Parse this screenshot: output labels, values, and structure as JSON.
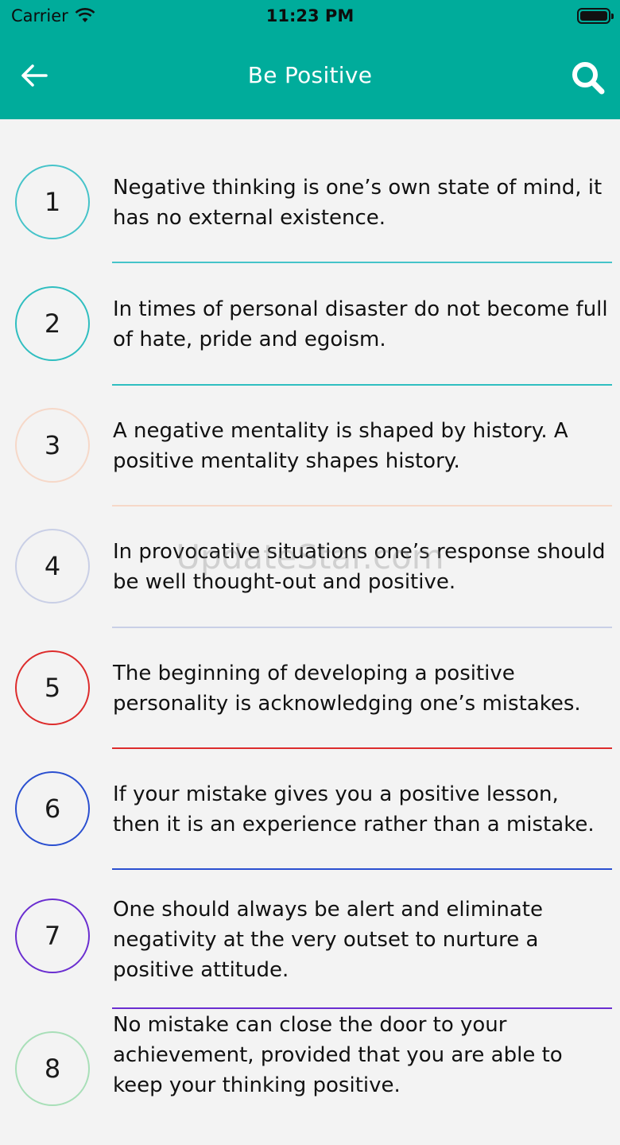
{
  "status": {
    "carrier": "Carrier",
    "time": "11:23 PM"
  },
  "header": {
    "title": "Be Positive",
    "back_icon": "arrow-left-icon",
    "search_icon": "search-icon"
  },
  "colors": {
    "header_bg": "#00ac9b"
  },
  "watermark": "UpdateStar.com",
  "quotes": [
    {
      "number": "1",
      "text": "Negative thinking is one’s own state of mind, it has no external existence.",
      "color": "#45c3c9"
    },
    {
      "number": "2",
      "text": "In times of personal disaster do not become full of hate, pride and egoism.",
      "color": "#2fbec0"
    },
    {
      "number": "3",
      "text": "A negative mentality is shaped by history. A positive mentality shapes history.",
      "color": "#f6d8c8"
    },
    {
      "number": "4",
      "text": "In provocative situations one’s response should be well thought-out and positive.",
      "color": "#c9cfe6"
    },
    {
      "number": "5",
      "text": "The beginning of developing a positive personality is acknowledging one’s mistakes.",
      "color": "#dd2c2c"
    },
    {
      "number": "6",
      "text": "If your mistake gives you a positive lesson, then it is an experience rather than a mistake.",
      "color": "#2a4fd0"
    },
    {
      "number": "7",
      "text": "One should always be alert and eliminate negativity at the very outset to nurture a positive attitude.",
      "color": "#6a2ed0"
    },
    {
      "number": "8",
      "text": "No mistake can close the door to your achievement, provided that you are able to keep your thinking positive.",
      "color": "#a8dfb8"
    }
  ]
}
